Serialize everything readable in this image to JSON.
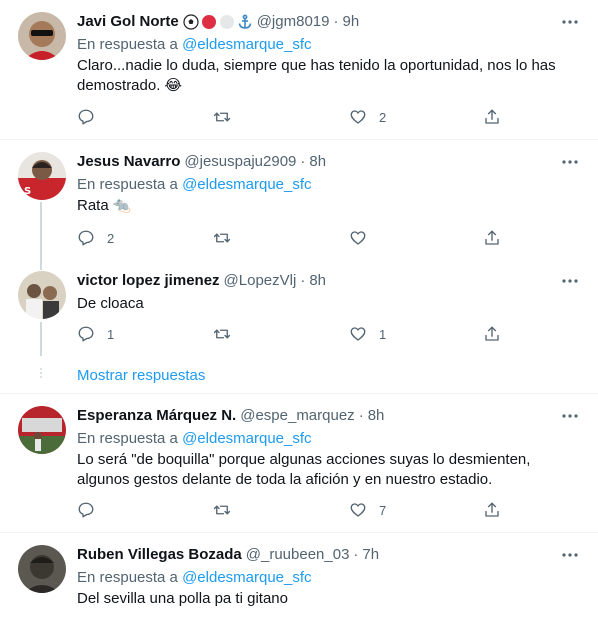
{
  "tweets": [
    {
      "name": "Javi Gol Norte",
      "handle": "@jgm8019",
      "time": "9h",
      "reply_prefix": "En respuesta a",
      "reply_to": "@eldesmarque_sfc",
      "text": "Claro...nadie lo duda, siempre que has tenido la oportunidad, nos lo has demostrado. 😂",
      "replies": "",
      "retweets": "",
      "likes": "2"
    },
    {
      "name": "Jesus Navarro",
      "handle": "@jesuspaju2909",
      "time": "8h",
      "reply_prefix": "En respuesta a",
      "reply_to": "@eldesmarque_sfc",
      "text": "Rata 🐀",
      "replies": "2",
      "retweets": "",
      "likes": ""
    },
    {
      "name": "victor lopez jimenez",
      "handle": "@LopezVlj",
      "time": "8h",
      "text": "De cloaca",
      "replies": "1",
      "retweets": "",
      "likes": "1"
    },
    {
      "name": "Esperanza Márquez N.",
      "handle": "@espe_marquez",
      "time": "8h",
      "reply_prefix": "En respuesta a",
      "reply_to": "@eldesmarque_sfc",
      "text": "Lo será \"de boquilla\" porque algunas acciones suyas lo desmienten, algunos gestos delante de toda la afición y en nuestro estadio.",
      "replies": "",
      "retweets": "",
      "likes": "7"
    },
    {
      "name": "Ruben Villegas Bozada",
      "handle": "@_ruubeen_03",
      "time": "7h",
      "reply_prefix": "En respuesta a",
      "reply_to": "@eldesmarque_sfc",
      "text": "Del sevilla una polla pa ti gitano"
    }
  ],
  "thread": {
    "show_more_label": "Mostrar respuestas"
  },
  "colors": {
    "accent": "#1d9bf0",
    "secondary_text": "#536471",
    "divider": "#eff3f4",
    "like_count_icon": "heart-icon"
  },
  "icons": {
    "reply": "reply-icon",
    "retweet": "retweet-icon",
    "like": "heart-icon",
    "share": "share-icon",
    "more": "more-icon"
  }
}
